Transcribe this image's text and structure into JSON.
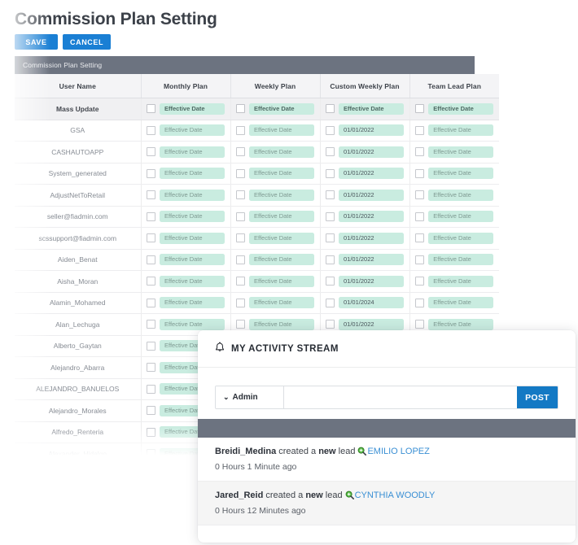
{
  "page": {
    "title": "Commission Plan Setting",
    "buttons": [
      {
        "label": "SAVE",
        "name": "save-button"
      },
      {
        "label": "CANCEL",
        "name": "cancel-button"
      }
    ],
    "section_bar_label": "Commission Plan Setting"
  },
  "table": {
    "columns": [
      "User Name",
      "Monthly Plan",
      "Weekly Plan",
      "Custom Weekly Plan",
      "Team Lead Plan"
    ],
    "date_placeholder": "Effective Date",
    "rows": [
      {
        "user": "Mass Update",
        "monthly": "",
        "weekly": "",
        "custom_weekly": "",
        "team_lead": ""
      },
      {
        "user": "GSA",
        "monthly": "",
        "weekly": "",
        "custom_weekly": "01/01/2022",
        "team_lead": ""
      },
      {
        "user": "CASHAUTOAPP",
        "monthly": "",
        "weekly": "",
        "custom_weekly": "01/01/2022",
        "team_lead": ""
      },
      {
        "user": "System_generated",
        "monthly": "",
        "weekly": "",
        "custom_weekly": "01/01/2022",
        "team_lead": ""
      },
      {
        "user": "AdjustNetToRetail",
        "monthly": "",
        "weekly": "",
        "custom_weekly": "01/01/2022",
        "team_lead": ""
      },
      {
        "user": "seller@fiadmin.com",
        "monthly": "",
        "weekly": "",
        "custom_weekly": "01/01/2022",
        "team_lead": ""
      },
      {
        "user": "scssupport@fiadmin.com",
        "monthly": "",
        "weekly": "",
        "custom_weekly": "01/01/2022",
        "team_lead": ""
      },
      {
        "user": "Aiden_Benat",
        "monthly": "",
        "weekly": "",
        "custom_weekly": "01/01/2022",
        "team_lead": ""
      },
      {
        "user": "Aisha_Moran",
        "monthly": "",
        "weekly": "",
        "custom_weekly": "01/01/2022",
        "team_lead": ""
      },
      {
        "user": "Alamin_Mohamed",
        "monthly": "",
        "weekly": "",
        "custom_weekly": "01/01/2024",
        "team_lead": ""
      },
      {
        "user": "Alan_Lechuga",
        "monthly": "",
        "weekly": "",
        "custom_weekly": "01/01/2022",
        "team_lead": ""
      },
      {
        "user": "Alberto_Gaytan",
        "monthly": "",
        "weekly": "",
        "custom_weekly": "",
        "team_lead": ""
      },
      {
        "user": "Alejandro_Abarra",
        "monthly": "",
        "weekly": "",
        "custom_weekly": "",
        "team_lead": ""
      },
      {
        "user": "ALEJANDRO_BANUELOS",
        "monthly": "",
        "weekly": "",
        "custom_weekly": "",
        "team_lead": ""
      },
      {
        "user": "Alejandro_Morales",
        "monthly": "",
        "weekly": "",
        "custom_weekly": "",
        "team_lead": ""
      },
      {
        "user": "Alfredo_Renteria",
        "monthly": "",
        "weekly": "",
        "custom_weekly": "",
        "team_lead": ""
      },
      {
        "user": "Alexander_Hidalgo",
        "monthly": "",
        "weekly": "",
        "custom_weekly": "",
        "team_lead": ""
      }
    ]
  },
  "activity_panel": {
    "title": "MY ACTIVITY STREAM",
    "bell_icon": "bell-icon",
    "composer": {
      "audience": "Admin",
      "input_value": "",
      "input_placeholder": "",
      "post_label": "POST"
    },
    "feed": [
      {
        "actor": "Breidi_Medina",
        "verb_before": "created a",
        "highlight": "new",
        "verb_after": "lead",
        "lead_icon": "magnifier-icon",
        "lead": "EMILIO LOPEZ",
        "time": "0 Hours 1 Minute ago"
      },
      {
        "actor": "Jared_Reid",
        "verb_before": "created a",
        "highlight": "new",
        "verb_after": "lead",
        "lead_icon": "magnifier-icon",
        "lead": "CYNTHIA WOODLY",
        "time": "0 Hours 12 Minutes ago"
      }
    ]
  },
  "colors": {
    "accent_blue": "#1a7fd4",
    "post_blue": "#1379c4",
    "slate_bar": "#6c7380",
    "mint_input": "#c9ece0",
    "link_blue": "#3a8fd4",
    "header_row": "#f4f4f6",
    "mass_update_row": "#f0f0f2"
  }
}
